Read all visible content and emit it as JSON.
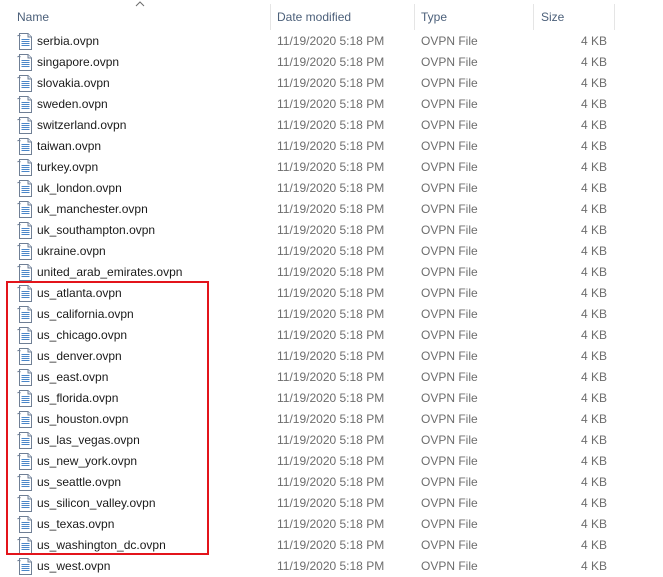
{
  "columns": {
    "name": "Name",
    "date": "Date modified",
    "type": "Type",
    "size": "Size"
  },
  "files": [
    {
      "name": "serbia.ovpn",
      "date": "11/19/2020 5:18 PM",
      "type": "OVPN File",
      "size": "4 KB"
    },
    {
      "name": "singapore.ovpn",
      "date": "11/19/2020 5:18 PM",
      "type": "OVPN File",
      "size": "4 KB"
    },
    {
      "name": "slovakia.ovpn",
      "date": "11/19/2020 5:18 PM",
      "type": "OVPN File",
      "size": "4 KB"
    },
    {
      "name": "sweden.ovpn",
      "date": "11/19/2020 5:18 PM",
      "type": "OVPN File",
      "size": "4 KB"
    },
    {
      "name": "switzerland.ovpn",
      "date": "11/19/2020 5:18 PM",
      "type": "OVPN File",
      "size": "4 KB"
    },
    {
      "name": "taiwan.ovpn",
      "date": "11/19/2020 5:18 PM",
      "type": "OVPN File",
      "size": "4 KB"
    },
    {
      "name": "turkey.ovpn",
      "date": "11/19/2020 5:18 PM",
      "type": "OVPN File",
      "size": "4 KB"
    },
    {
      "name": "uk_london.ovpn",
      "date": "11/19/2020 5:18 PM",
      "type": "OVPN File",
      "size": "4 KB"
    },
    {
      "name": "uk_manchester.ovpn",
      "date": "11/19/2020 5:18 PM",
      "type": "OVPN File",
      "size": "4 KB"
    },
    {
      "name": "uk_southampton.ovpn",
      "date": "11/19/2020 5:18 PM",
      "type": "OVPN File",
      "size": "4 KB"
    },
    {
      "name": "ukraine.ovpn",
      "date": "11/19/2020 5:18 PM",
      "type": "OVPN File",
      "size": "4 KB"
    },
    {
      "name": "united_arab_emirates.ovpn",
      "date": "11/19/2020 5:18 PM",
      "type": "OVPN File",
      "size": "4 KB"
    },
    {
      "name": "us_atlanta.ovpn",
      "date": "11/19/2020 5:18 PM",
      "type": "OVPN File",
      "size": "4 KB"
    },
    {
      "name": "us_california.ovpn",
      "date": "11/19/2020 5:18 PM",
      "type": "OVPN File",
      "size": "4 KB"
    },
    {
      "name": "us_chicago.ovpn",
      "date": "11/19/2020 5:18 PM",
      "type": "OVPN File",
      "size": "4 KB"
    },
    {
      "name": "us_denver.ovpn",
      "date": "11/19/2020 5:18 PM",
      "type": "OVPN File",
      "size": "4 KB"
    },
    {
      "name": "us_east.ovpn",
      "date": "11/19/2020 5:18 PM",
      "type": "OVPN File",
      "size": "4 KB"
    },
    {
      "name": "us_florida.ovpn",
      "date": "11/19/2020 5:18 PM",
      "type": "OVPN File",
      "size": "4 KB"
    },
    {
      "name": "us_houston.ovpn",
      "date": "11/19/2020 5:18 PM",
      "type": "OVPN File",
      "size": "4 KB"
    },
    {
      "name": "us_las_vegas.ovpn",
      "date": "11/19/2020 5:18 PM",
      "type": "OVPN File",
      "size": "4 KB"
    },
    {
      "name": "us_new_york.ovpn",
      "date": "11/19/2020 5:18 PM",
      "type": "OVPN File",
      "size": "4 KB"
    },
    {
      "name": "us_seattle.ovpn",
      "date": "11/19/2020 5:18 PM",
      "type": "OVPN File",
      "size": "4 KB"
    },
    {
      "name": "us_silicon_valley.ovpn",
      "date": "11/19/2020 5:18 PM",
      "type": "OVPN File",
      "size": "4 KB"
    },
    {
      "name": "us_texas.ovpn",
      "date": "11/19/2020 5:18 PM",
      "type": "OVPN File",
      "size": "4 KB"
    },
    {
      "name": "us_washington_dc.ovpn",
      "date": "11/19/2020 5:18 PM",
      "type": "OVPN File",
      "size": "4 KB"
    },
    {
      "name": "us_west.ovpn",
      "date": "11/19/2020 5:18 PM",
      "type": "OVPN File",
      "size": "4 KB"
    }
  ],
  "sort": {
    "column": "name",
    "direction": "ascending",
    "icon": "chevron-up-icon"
  },
  "file_icon": "ovpn-file-icon",
  "highlight": {
    "color": "#e3141b",
    "first_row": 12,
    "last_row": 24
  }
}
